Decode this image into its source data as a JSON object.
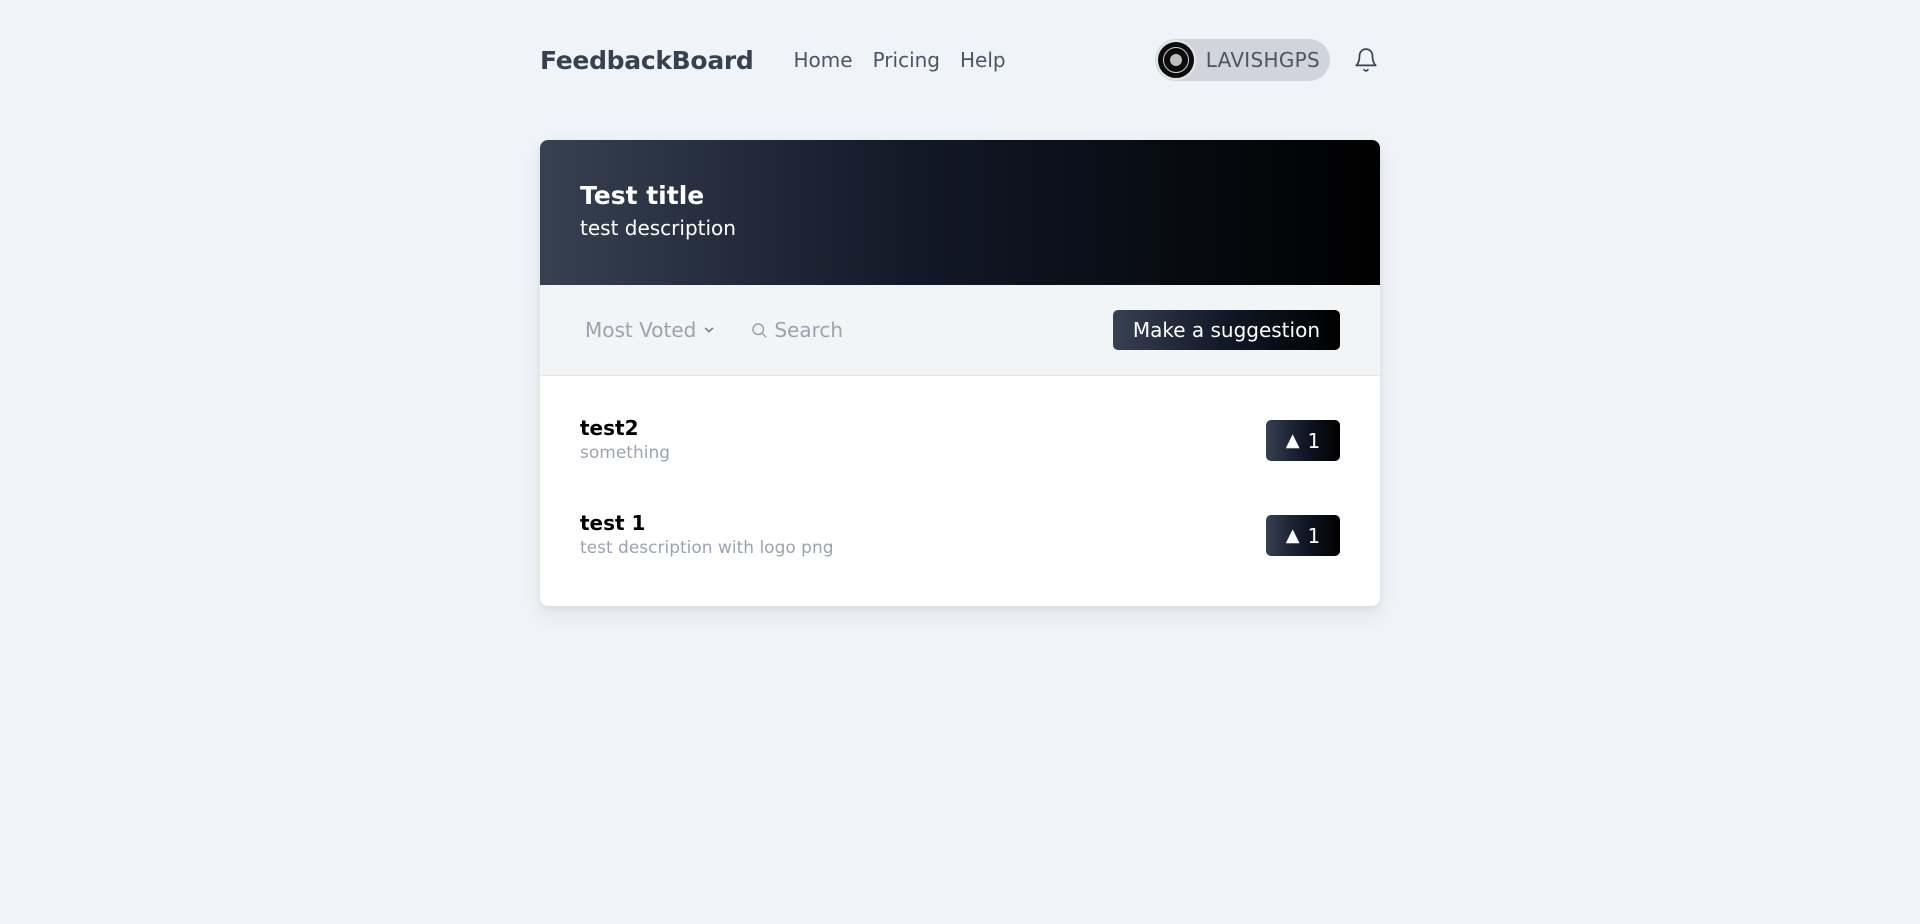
{
  "navbar": {
    "brand": "FeedbackBoard",
    "links": [
      {
        "label": "Home"
      },
      {
        "label": "Pricing"
      },
      {
        "label": "Help"
      }
    ],
    "user": {
      "username": "LAVISHGPS"
    },
    "icons": {
      "bell": "bell-icon",
      "avatar": "avatar-image"
    }
  },
  "board": {
    "title": "Test title",
    "description": "test description"
  },
  "toolbar": {
    "sort_label": "Most Voted",
    "search_placeholder": "Search",
    "suggest_label": "Make a suggestion"
  },
  "suggestions": [
    {
      "title": "test2",
      "description": "something",
      "vote_arrow": "▲",
      "votes": "1"
    },
    {
      "title": "test 1",
      "description": "test description with logo png",
      "vote_arrow": "▲",
      "votes": "1"
    }
  ],
  "colors": {
    "background": "#f0f4f8",
    "gradient_start": "#374151",
    "gradient_end": "#000000",
    "muted_text": "#9ca3af"
  }
}
